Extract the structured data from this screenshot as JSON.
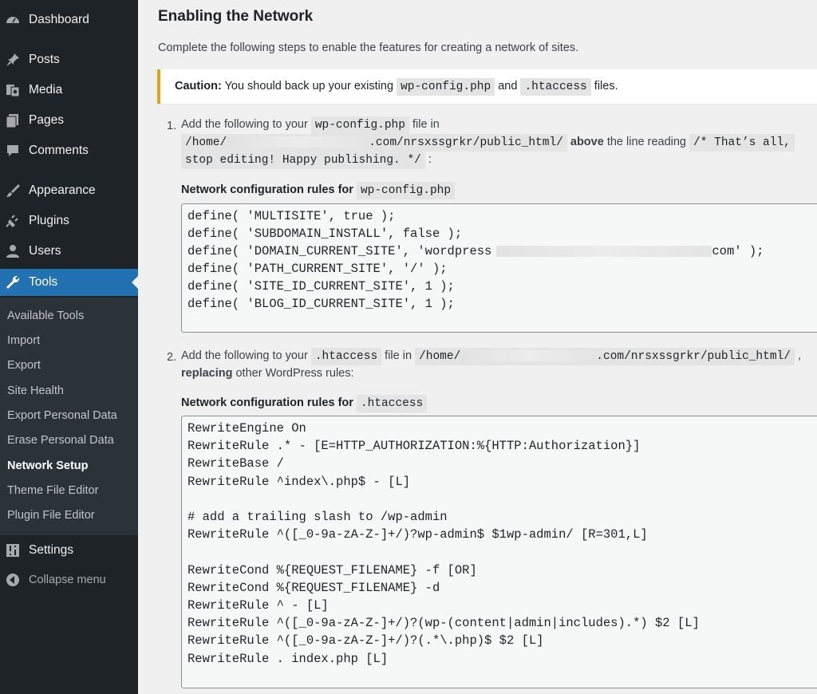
{
  "sidebar": {
    "menu": [
      {
        "label": "Dashboard",
        "icon": "dashboard-icon"
      },
      {
        "label": "Posts",
        "icon": "pin-icon"
      },
      {
        "label": "Media",
        "icon": "media-icon"
      },
      {
        "label": "Pages",
        "icon": "pages-icon"
      },
      {
        "label": "Comments",
        "icon": "comment-icon"
      },
      {
        "label": "Appearance",
        "icon": "brush-icon"
      },
      {
        "label": "Plugins",
        "icon": "plug-icon"
      },
      {
        "label": "Users",
        "icon": "user-icon"
      },
      {
        "label": "Tools",
        "icon": "wrench-icon"
      }
    ],
    "submenu": [
      "Available Tools",
      "Import",
      "Export",
      "Site Health",
      "Export Personal Data",
      "Erase Personal Data",
      "Network Setup",
      "Theme File Editor",
      "Plugin File Editor"
    ],
    "settings": {
      "label": "Settings",
      "icon": "settings-icon"
    },
    "collapse": {
      "label": "Collapse menu",
      "icon": "collapse-icon"
    },
    "accent": "#2271b1"
  },
  "page": {
    "title": "Enabling the Network",
    "intro": "Complete the following steps to enable the features for creating a network of sites.",
    "caution": {
      "bold": "Caution:",
      "text1": " You should back up your existing ",
      "code1": "wp-config.php",
      "text2": " and ",
      "code2": ".htaccess",
      "text3": " files."
    },
    "step1": {
      "num": "1.",
      "pre": "Add the following to your ",
      "code_file": "wp-config.php",
      "mid": " file in",
      "path_start": "/home/",
      "path_end": ".com/nrsxssgrkr/public_html/",
      "above": "above",
      "reading": " the line reading ",
      "code_line1": "/* That’s all,",
      "code_line2": "stop editing! Happy publishing. */",
      "colon": " :",
      "rules_label": "Network configuration rules for ",
      "rules_code": "wp-config.php",
      "lines": [
        "define( 'MULTISITE', true );",
        "define( 'SUBDOMAIN_INSTALL', false );",
        "define( 'DOMAIN_CURRENT_SITE', 'wordpress",
        "define( 'PATH_CURRENT_SITE', '/' );",
        "define( 'SITE_ID_CURRENT_SITE', 1 );",
        "define( 'BLOG_ID_CURRENT_SITE', 1 );"
      ],
      "domain_tail": "com' );"
    },
    "step2": {
      "num": "2.",
      "pre": "Add the following to your ",
      "code_file": ".htaccess",
      "mid": " file in ",
      "path_start": "/home/",
      "path_end": ".com/nrsxssgrkr/public_html/",
      "comma": " ,",
      "replacing": "replacing",
      "rest": " other WordPress rules:",
      "rules_label": "Network configuration rules for ",
      "rules_code": ".htaccess",
      "lines": [
        "RewriteEngine On",
        "RewriteRule .* - [E=HTTP_AUTHORIZATION:%{HTTP:Authorization}]",
        "RewriteBase /",
        "RewriteRule ^index\\.php$ - [L]",
        "",
        "# add a trailing slash to /wp-admin",
        "RewriteRule ^([_0-9a-zA-Z-]+/)?wp-admin$ $1wp-admin/ [R=301,L]",
        "",
        "RewriteCond %{REQUEST_FILENAME} -f [OR]",
        "RewriteCond %{REQUEST_FILENAME} -d",
        "RewriteRule ^ - [L]",
        "RewriteRule ^([_0-9a-zA-Z-]+/)?(wp-(content|admin|includes).*) $2 [L]",
        "RewriteRule ^([_0-9a-zA-Z-]+/)?(.*\\.php)$ $2 [L]",
        "RewriteRule . index.php [L]"
      ]
    }
  }
}
